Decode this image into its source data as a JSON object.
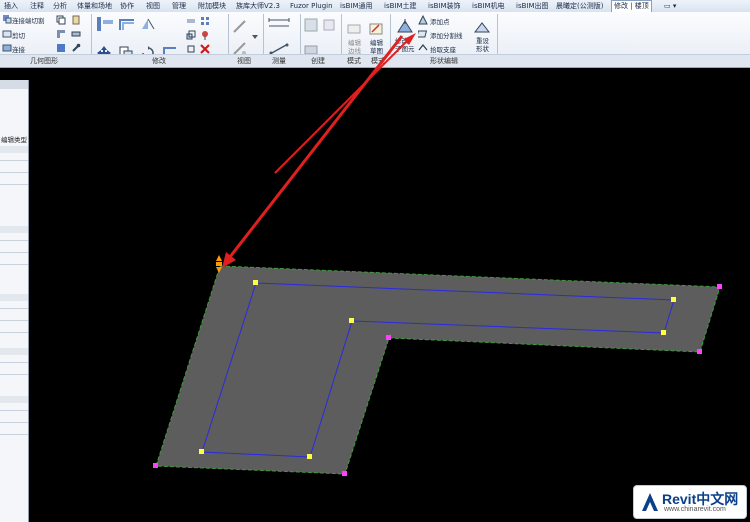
{
  "menu": {
    "tabs": [
      "插入",
      "注释",
      "分析",
      "体量和场地",
      "协作",
      "视图",
      "管理",
      "附加模块",
      "族库大师V2.3",
      "Fuzor Plugin",
      "isBIM通用",
      "isBIM土建",
      "isBIM装饰",
      "isBIM机电",
      "isBIM出图",
      "晨曦定(公测版)",
      "修改 | 楼顶"
    ],
    "active_index": 16
  },
  "ribbon": {
    "geometry_items": [
      "连接端切割",
      "剪切",
      "连接"
    ],
    "edit_items": [
      "编辑\n边线",
      "编辑\n草图",
      "修改\n子图元"
    ],
    "shape_items": [
      "添加点",
      "添加分割线",
      "拾取支座"
    ],
    "reset_label": "重设\n形状"
  },
  "panels": {
    "labels": [
      "几何图形",
      "修改",
      "视图",
      "测量",
      "创建",
      "模式",
      "模式",
      "形状编辑"
    ]
  },
  "properties": {
    "edit_type": "编辑类型"
  },
  "logo": {
    "main": "Revit中文网",
    "sub": "www.chinarevit.com"
  },
  "colors": {
    "background": "#000000",
    "floor_fill": "#5d5d5d",
    "floor_edge": "#3a8a3a",
    "sketch_line": "#2020d0",
    "point_yellow": "#ffff40",
    "point_magenta": "#ff40ff",
    "arrow_red": "#e02020"
  }
}
